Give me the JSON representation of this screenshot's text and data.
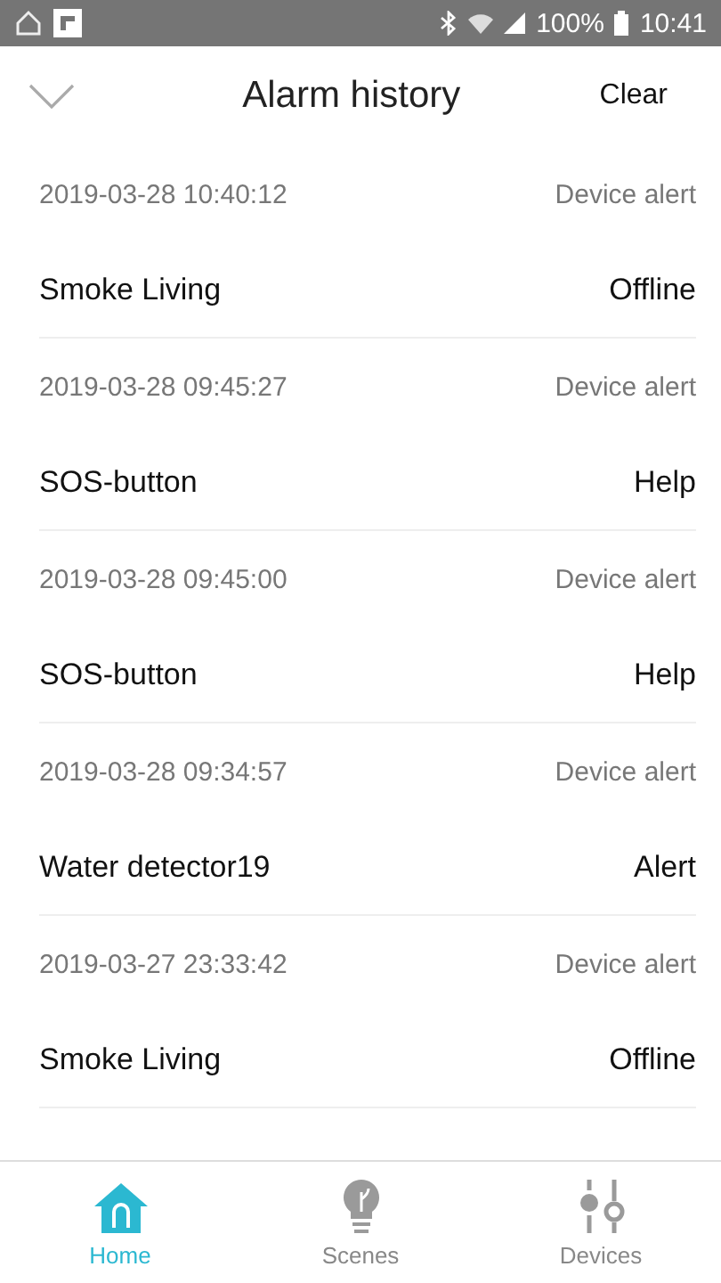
{
  "status_bar": {
    "battery": "100%",
    "time": "10:41"
  },
  "header": {
    "title": "Alarm history",
    "action": "Clear"
  },
  "alarms": [
    {
      "time": "2019-03-28 10:40:12",
      "type": "Device alert",
      "device": "Smoke Living",
      "status": "Offline"
    },
    {
      "time": "2019-03-28 09:45:27",
      "type": "Device alert",
      "device": "SOS-button",
      "status": "Help"
    },
    {
      "time": "2019-03-28 09:45:00",
      "type": "Device alert",
      "device": "SOS-button",
      "status": "Help"
    },
    {
      "time": "2019-03-28 09:34:57",
      "type": "Device alert",
      "device": "Water detector19",
      "status": "Alert"
    },
    {
      "time": "2019-03-27 23:33:42",
      "type": "Device alert",
      "device": "Smoke Living",
      "status": "Offline"
    }
  ],
  "tabs": [
    {
      "label": "Home",
      "selected": true
    },
    {
      "label": "Scenes",
      "selected": false
    },
    {
      "label": "Devices",
      "selected": false
    }
  ]
}
